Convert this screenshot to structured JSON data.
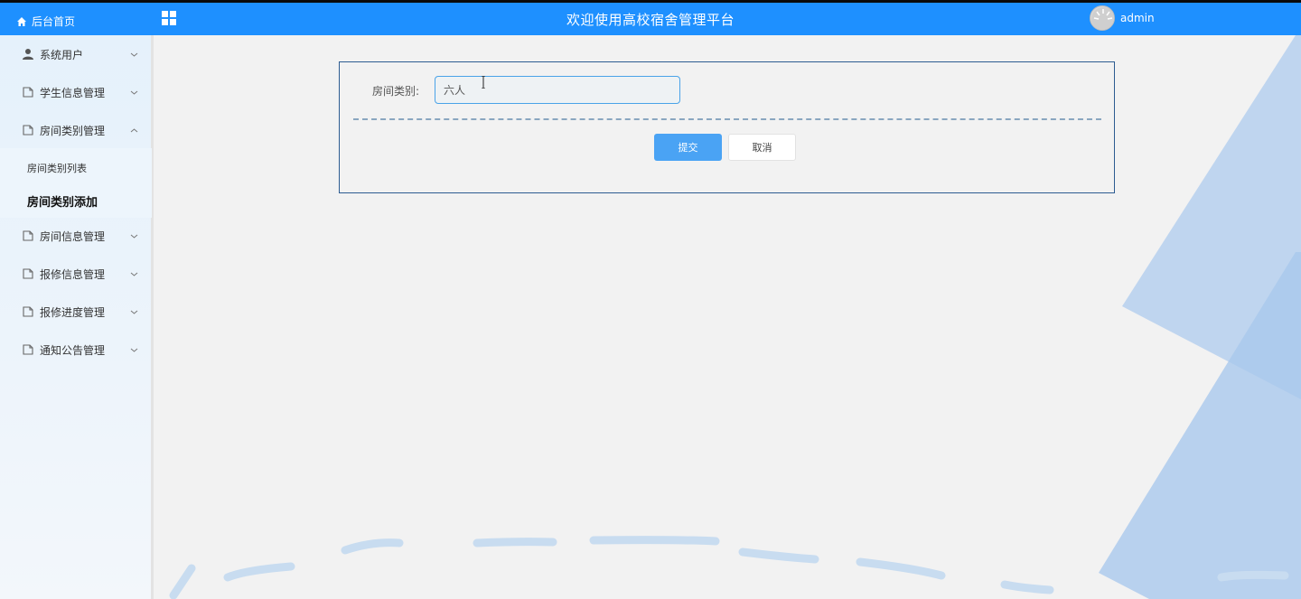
{
  "header": {
    "home_label": "后台首页",
    "home_icon": "home-icon",
    "grid_icon": "grid-icon",
    "title": "欢迎使用高校宿舍管理平台",
    "username": "admin",
    "bar_color": "#1e90ff"
  },
  "sidebar": {
    "items": [
      {
        "label": "系统用户",
        "icon": "user-icon",
        "expanded": false
      },
      {
        "label": "学生信息管理",
        "icon": "document-icon",
        "expanded": false
      },
      {
        "label": "房间类别管理",
        "icon": "document-icon",
        "expanded": true
      },
      {
        "label": "房间信息管理",
        "icon": "document-icon",
        "expanded": false
      },
      {
        "label": "报修信息管理",
        "icon": "document-icon",
        "expanded": false
      },
      {
        "label": "报修进度管理",
        "icon": "document-icon",
        "expanded": false
      },
      {
        "label": "通知公告管理",
        "icon": "document-icon",
        "expanded": false
      }
    ],
    "submenu": [
      {
        "label": "房间类别列表",
        "active": false
      },
      {
        "label": "房间类别添加",
        "active": true
      }
    ]
  },
  "form": {
    "field_label": "房间类别:",
    "field_value": "六人",
    "submit_label": "提交",
    "cancel_label": "取消",
    "accent_color": "#4aa3f4",
    "border_color": "#2d5c91"
  }
}
